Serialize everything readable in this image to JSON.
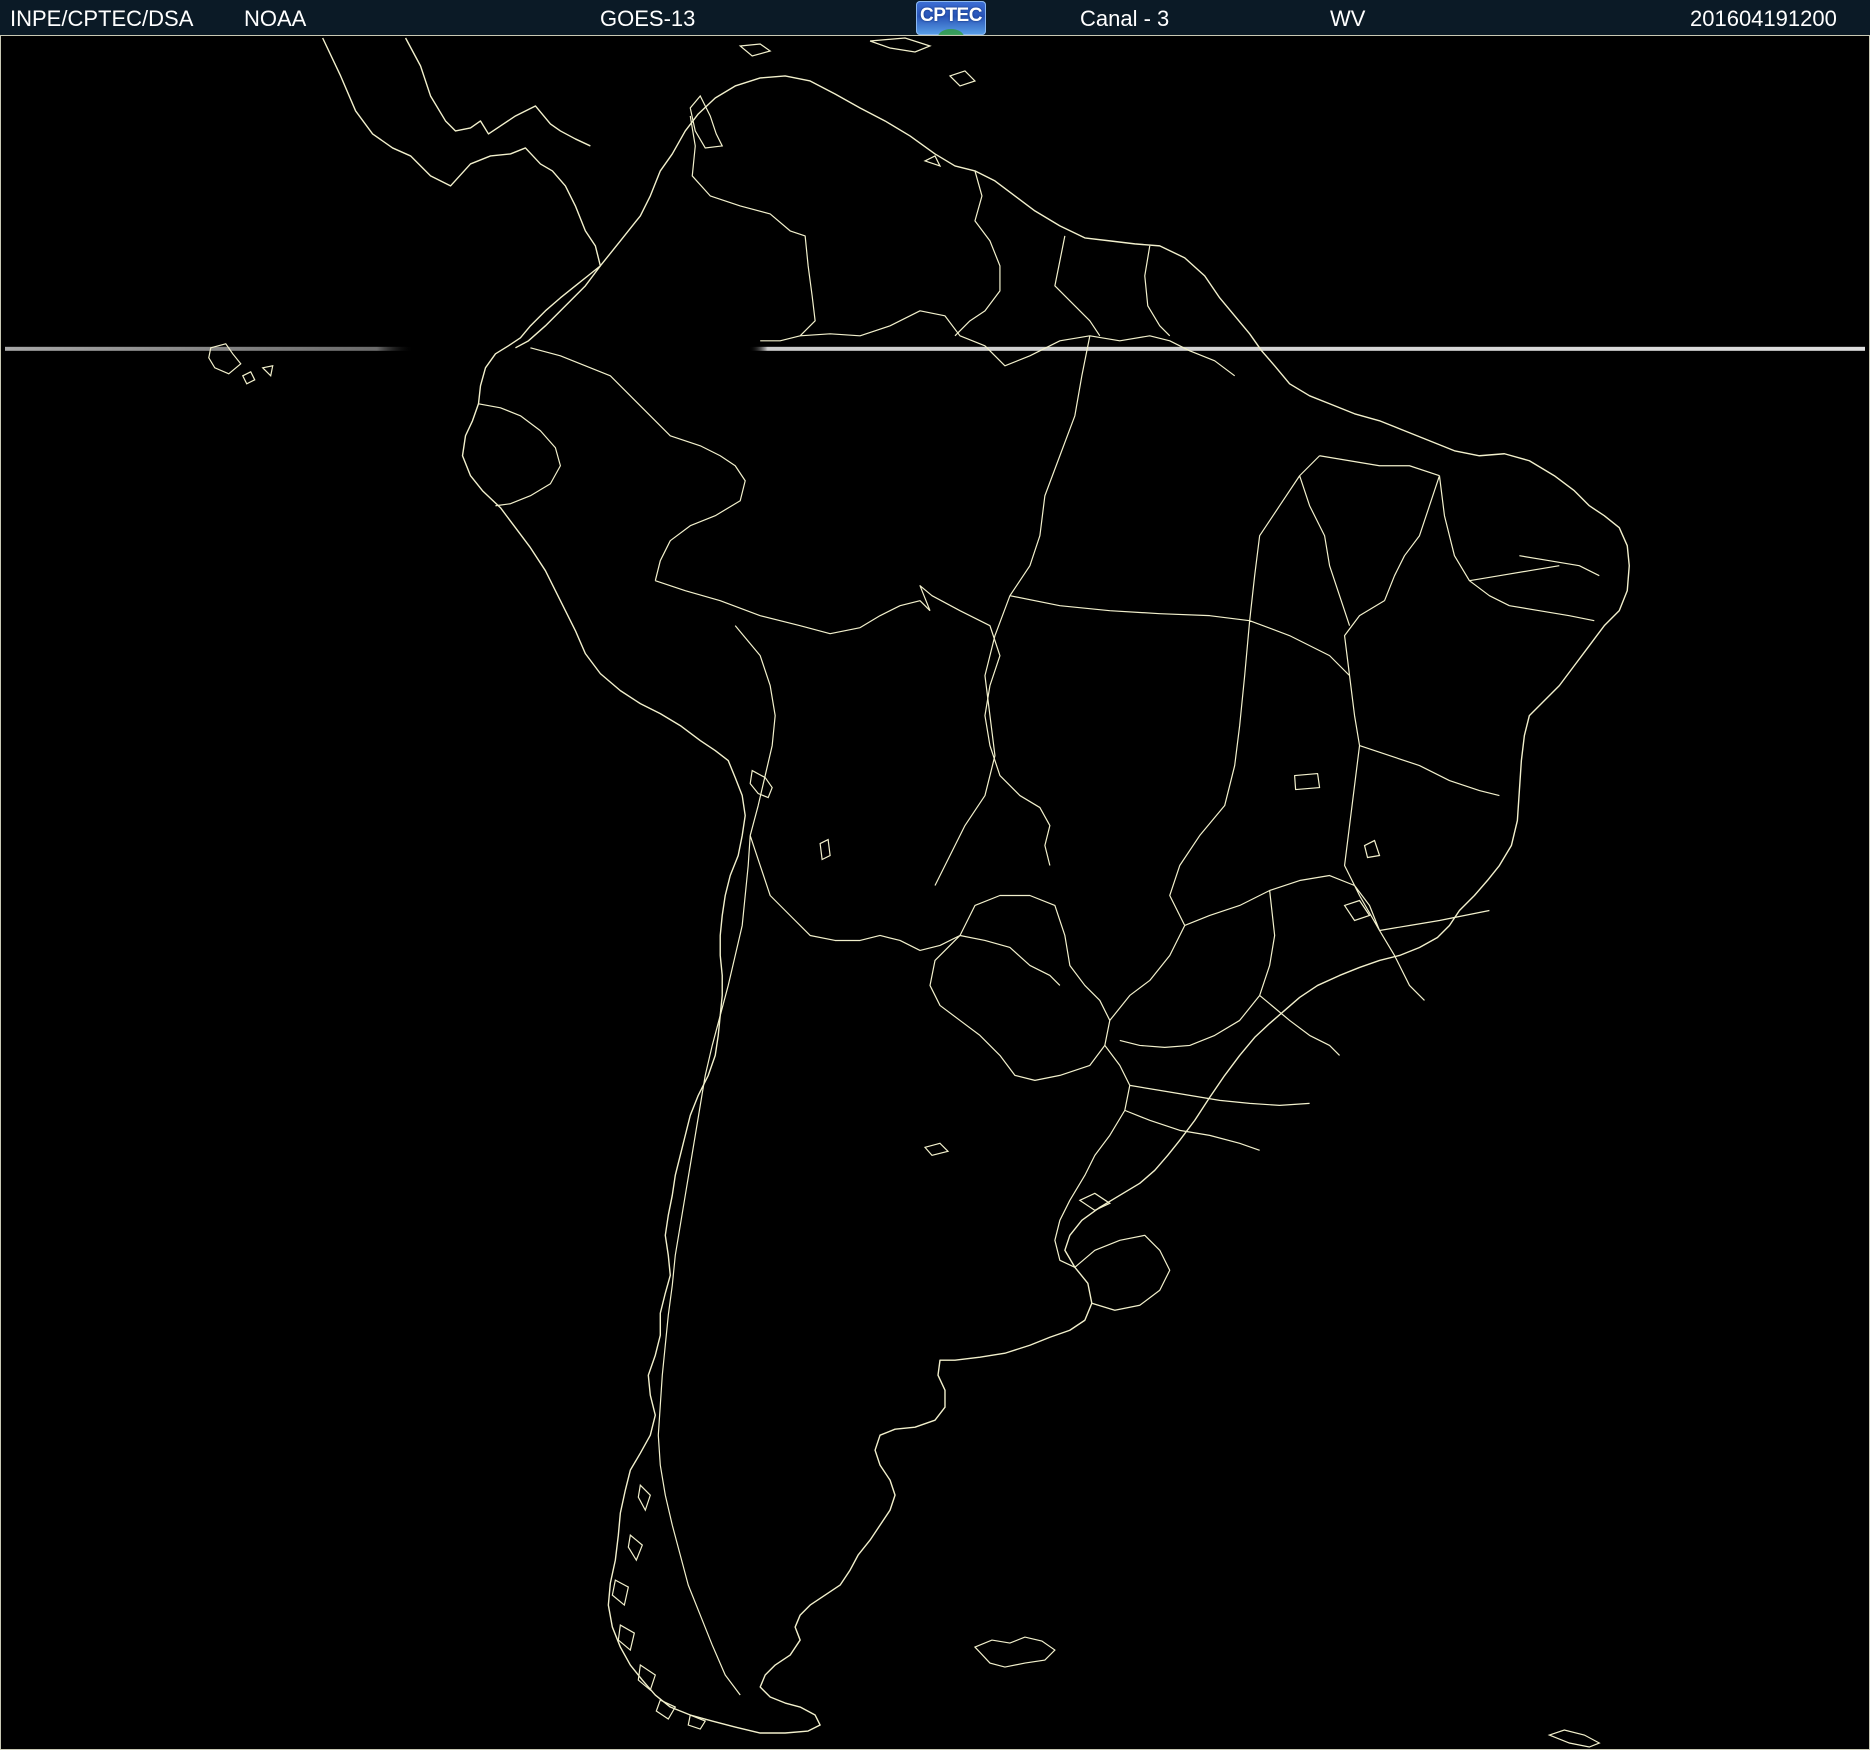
{
  "header": {
    "source": "INPE/CPTEC/DSA",
    "agency": "NOAA",
    "satellite": "GOES-13",
    "logo_text": "CPTEC",
    "channel": "Canal - 3",
    "band": "WV",
    "timestamp": "201604191200"
  },
  "colors": {
    "background": "#000000",
    "header_background": "#0b1a26",
    "outline": "#f2f0cc",
    "scan_line": "#d8d8d8",
    "logo": "#2a55b8"
  },
  "map": {
    "region": "South America",
    "features": [
      "coastlines",
      "country-borders",
      "brazil-state-borders",
      "scan-line-artifact"
    ]
  }
}
